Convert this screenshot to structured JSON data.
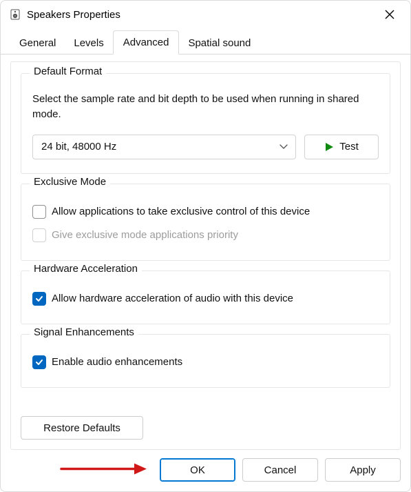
{
  "window": {
    "title": "Speakers Properties"
  },
  "tabs": {
    "general": "General",
    "levels": "Levels",
    "advanced": "Advanced",
    "spatial": "Spatial sound"
  },
  "defaultFormat": {
    "legend": "Default Format",
    "desc": "Select the sample rate and bit depth to be used when running in shared mode.",
    "selected": "24 bit, 48000 Hz",
    "testLabel": "Test"
  },
  "exclusiveMode": {
    "legend": "Exclusive Mode",
    "allowExclusive": "Allow applications to take exclusive control of this device",
    "givePriority": "Give exclusive mode applications priority"
  },
  "hardwareAccel": {
    "legend": "Hardware Acceleration",
    "allowHw": "Allow hardware acceleration of audio with this device"
  },
  "signalEnh": {
    "legend": "Signal Enhancements",
    "enable": "Enable audio enhancements"
  },
  "buttons": {
    "restore": "Restore Defaults",
    "ok": "OK",
    "cancel": "Cancel",
    "apply": "Apply"
  }
}
